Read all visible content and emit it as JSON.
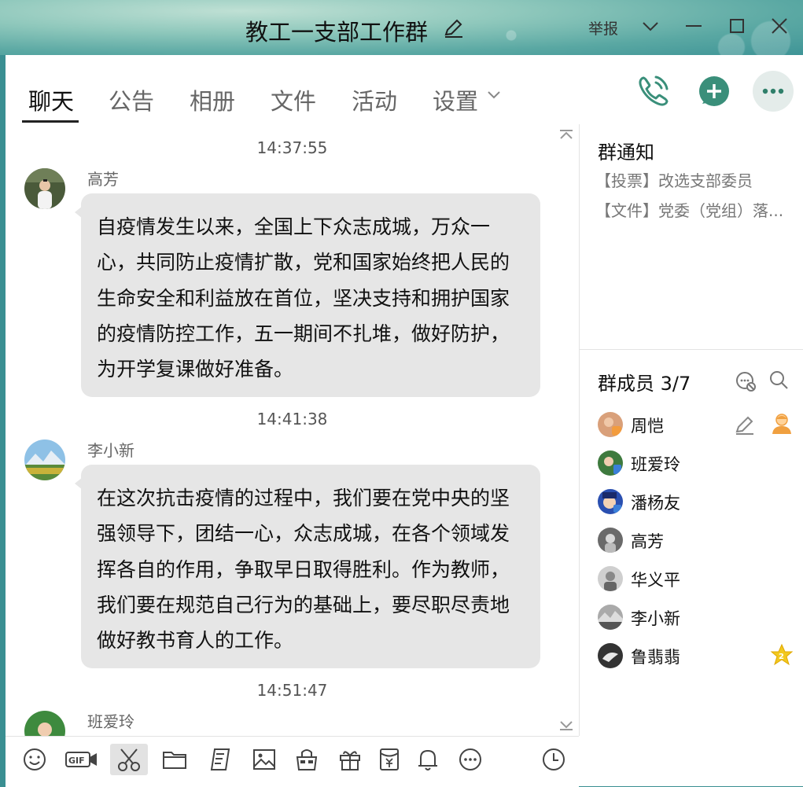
{
  "window": {
    "title": "教工一支部工作群",
    "report_label": "举报"
  },
  "tabs": [
    {
      "label": "聊天",
      "active": true
    },
    {
      "label": "公告"
    },
    {
      "label": "相册"
    },
    {
      "label": "文件"
    },
    {
      "label": "活动"
    },
    {
      "label": "设置"
    }
  ],
  "messages": [
    {
      "time": "14:37:55",
      "sender": "高芳",
      "text": "自疫情发生以来，全国上下众志成城，万众一心，共同防止疫情扩散，党和国家始终把人民的生命安全和利益放在首位，坚决支持和拥护国家的疫情防控工作，五一期间不扎堆，做好防护，为开学复课做好准备。"
    },
    {
      "time": "14:41:38",
      "sender": "李小新",
      "text": "在这次抗击疫情的过程中，我们要在党中央的坚强领导下，团结一心，众志成城，在各个领域发挥各自的作用，争取早日取得胜利。作为教师，我们要在规范自己行为的基础上，要尽职尽责地做好教书育人的工作。"
    },
    {
      "time": "14:51:47",
      "sender": "班爱玲"
    }
  ],
  "side": {
    "notice_title": "群通知",
    "notices": [
      "【投票】改选支部委员",
      "【文件】党委（党组）落..."
    ],
    "members_title": "群成员 3/7",
    "members": [
      "周恺",
      "班爱玲",
      "潘杨友",
      "高芳",
      "华义平",
      "李小新",
      "鲁翡翡"
    ]
  },
  "colors": {
    "accent": "#3a8f7a",
    "title_bg": "#7fbcb3",
    "bubble": "#e6e6e6",
    "star": "#f2c81e"
  }
}
